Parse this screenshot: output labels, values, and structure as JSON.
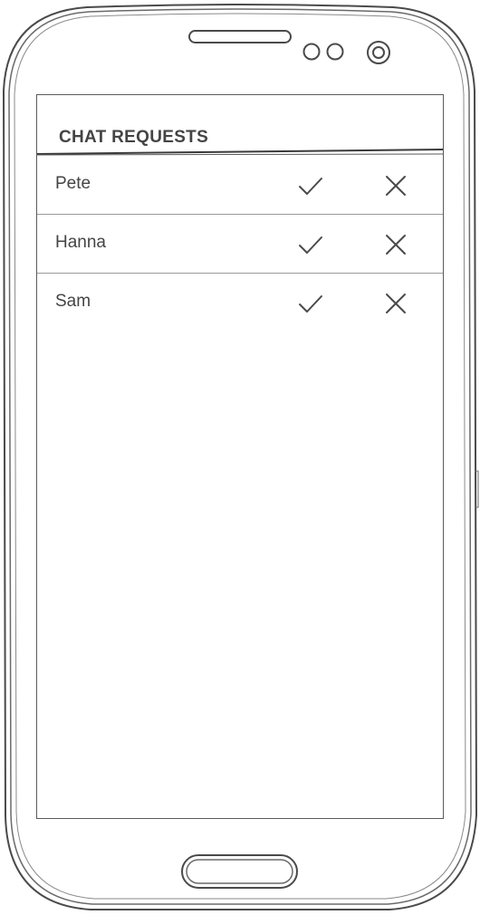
{
  "screen": {
    "title": "CHAT REQUESTS"
  },
  "requests": [
    {
      "name": "Pete"
    },
    {
      "name": "Hanna"
    },
    {
      "name": "Sam"
    }
  ],
  "icons": {
    "accept": "checkmark-icon",
    "decline": "close-icon"
  },
  "colors": {
    "stroke": "#4a4a4a",
    "text": "#444444"
  }
}
